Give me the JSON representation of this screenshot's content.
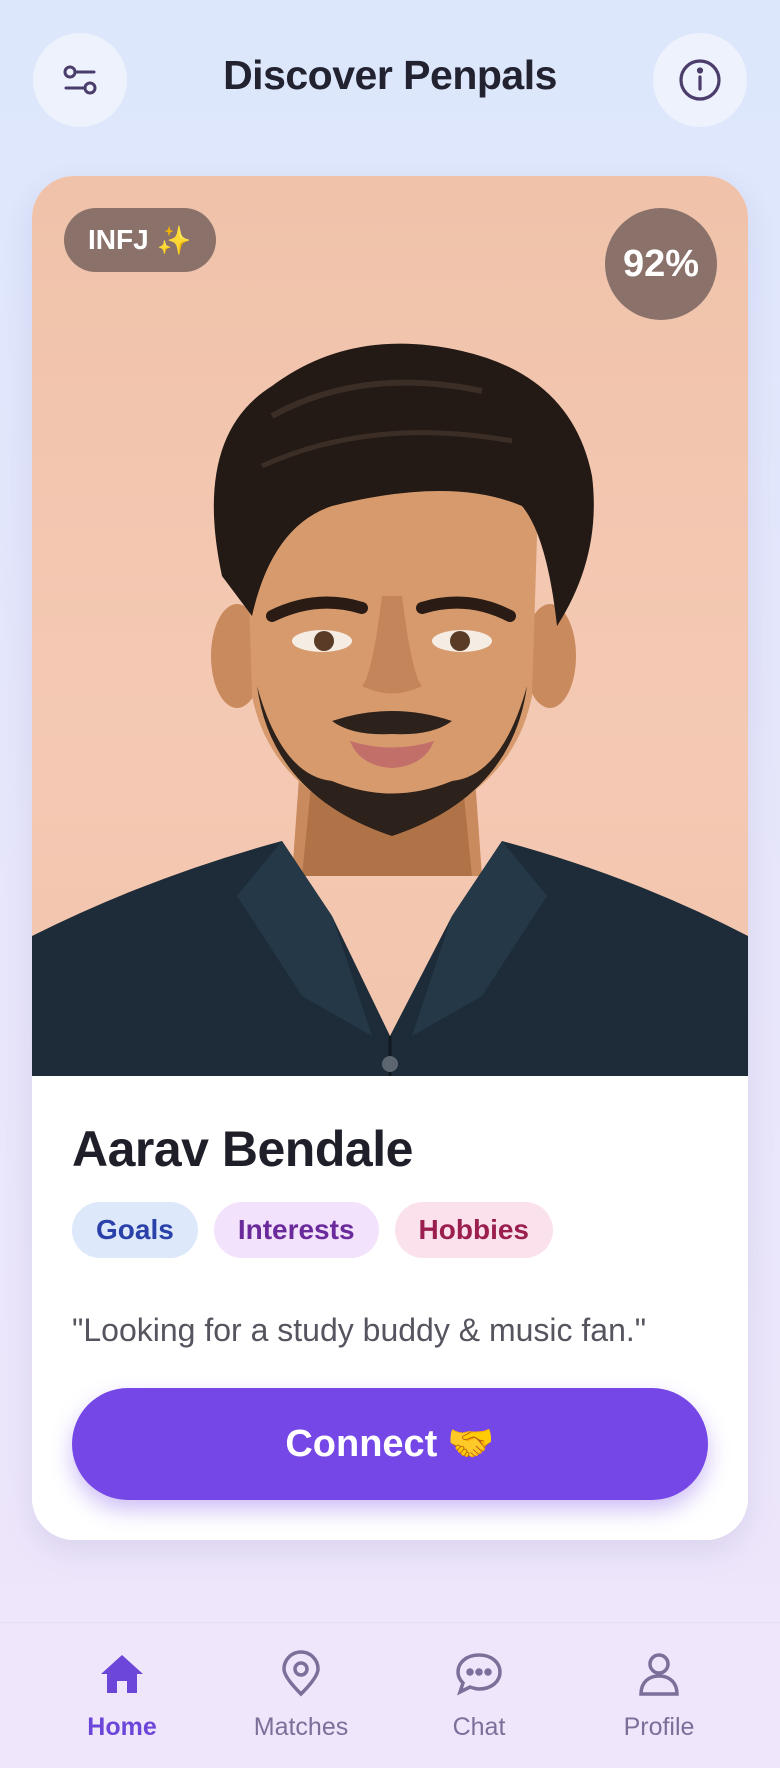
{
  "header": {
    "title": "Discover Penpals",
    "filter_icon": "sliders-icon",
    "info_icon": "info-icon"
  },
  "profile": {
    "mbti": "INFJ",
    "mbti_emoji": "✨",
    "match": "92%",
    "name": "Aarav Bendale",
    "tags": {
      "goals": "Goals",
      "interests": "Interests",
      "hobbies": "Hobbies"
    },
    "quote": "\"Looking for a study buddy & music fan.\""
  },
  "actions": {
    "connect_label": "Connect",
    "connect_emoji": "🤝"
  },
  "nav": {
    "home": "Home",
    "matches": "Matches",
    "chat": "Chat",
    "profile": "Profile"
  },
  "colors": {
    "accent": "#7547e6",
    "nav_active": "#6c46d9",
    "nav_inactive": "#7d6e9a"
  }
}
